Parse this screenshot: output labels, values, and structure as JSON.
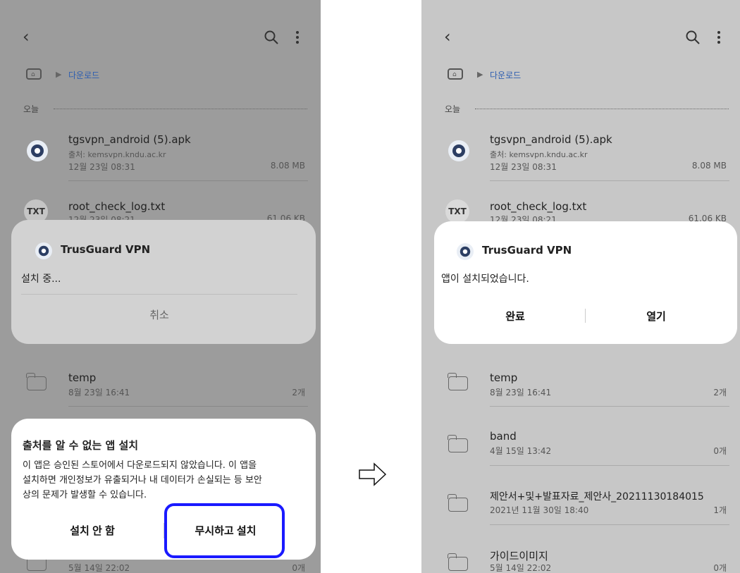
{
  "breadcrumb": {
    "current": "다운로드"
  },
  "section_today": "오늘",
  "files": [
    {
      "name": "tgsvpn_android (5).apk",
      "source": "출처: kemsvpn.kndu.ac.kr",
      "date": "12월 23일 08:31",
      "size": "8.08 MB"
    },
    {
      "name": "root_check_log.txt",
      "date": "12월 23일 08:21",
      "size": "61.06 KB",
      "icon_label": "TXT"
    }
  ],
  "folders": [
    {
      "name": "temp",
      "date": "8월 23일 16:41",
      "count": "2개"
    },
    {
      "name": "band",
      "date": "4월 15일 13:42",
      "count": "0개"
    },
    {
      "name": "제안서+및+발표자료_제안사_20211130184015",
      "date": "2021년 11월 30일 18:40",
      "count": "1개"
    },
    {
      "name": "가이드이미지",
      "date": "5월 14일 22:02",
      "count": "0개"
    }
  ],
  "installing_dialog": {
    "app_name": "TrusGuard VPN",
    "status": "설치 중...",
    "cancel": "취소"
  },
  "unknown_source_dialog": {
    "title": "출처를 알 수 없는 앱 설치",
    "lines": [
      "이 앱은 승인된 스토어에서 다운로드되지 않았습니다. 이 앱을",
      "설치하면 개인정보가 유출되거나 내 데이터가 손실되는 등 보안",
      "상의 문제가 발생할 수 있습니다."
    ],
    "deny": "설치 안 함",
    "install_anyway": "무시하고 설치"
  },
  "installed_dialog": {
    "app_name": "TrusGuard VPN",
    "message": "앱이 설치되었습니다.",
    "done": "완료",
    "open": "열기"
  },
  "colors": {
    "highlight": "#1a1aff",
    "breadcrumb": "#2f5fb0",
    "app_icon": "#2c3e63"
  }
}
